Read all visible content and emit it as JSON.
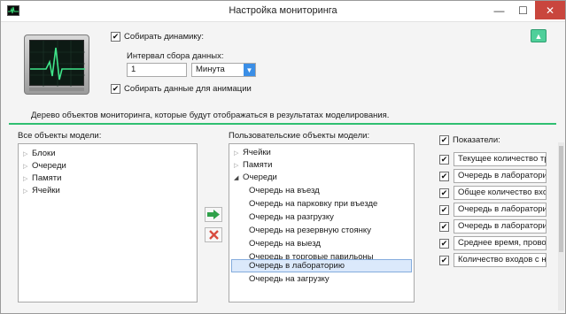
{
  "window": {
    "title": "Настройка мониторинга",
    "controls": {
      "minimize": "—",
      "maximize": "☐",
      "close": "✕"
    }
  },
  "settings": {
    "collect_dynamics_label": "Собирать динамику:",
    "collect_dynamics_checked": true,
    "interval_label": "Интервал сбора данных:",
    "interval_value": "1",
    "interval_unit": "Минута",
    "collect_animation_label": "Собирать данные для анимации",
    "collect_animation_checked": true
  },
  "info_text": "Дерево объектов мониторинга, которые будут отображаться в результатах моделирования.",
  "all_objects": {
    "label": "Все объекты модели:",
    "items": [
      "Блоки",
      "Очереди",
      "Памяти",
      "Ячейки"
    ]
  },
  "user_objects": {
    "label": "Пользовательские объекты модели:",
    "items": [
      {
        "text": "Ячейки",
        "level": 0,
        "expanded": false
      },
      {
        "text": "Памяти",
        "level": 0,
        "expanded": false
      },
      {
        "text": "Очереди",
        "level": 0,
        "expanded": true
      },
      {
        "text": "Очередь на въезд",
        "level": 1
      },
      {
        "text": "Очередь на парковку при въезде",
        "level": 1
      },
      {
        "text": "Очередь на разгрузку",
        "level": 1
      },
      {
        "text": "Очередь на резервную стоянку",
        "level": 1
      },
      {
        "text": "Очередь на выезд",
        "level": 1
      },
      {
        "text": "Очередь в торговые павильоны",
        "level": 1
      },
      {
        "text": "Очередь в лабораторию",
        "level": 1,
        "selected": true
      },
      {
        "text": "Очередь на загрузку",
        "level": 1
      }
    ]
  },
  "indicators": {
    "label": "Показатели:",
    "header_checked": true,
    "items": [
      {
        "text": "Текущее количество тран",
        "checked": true
      },
      {
        "text": "Очередь в лабораторию.",
        "checked": true
      },
      {
        "text": "Общее количество входо",
        "checked": true
      },
      {
        "text": "Очередь в лабораторию.",
        "checked": true
      },
      {
        "text": "Очередь в лабораторию.",
        "checked": true
      },
      {
        "text": "Среднее время, проводи",
        "checked": true
      },
      {
        "text": "Количество входов с нул",
        "checked": true
      }
    ]
  },
  "icons": {
    "add": "arrow-right-icon",
    "remove": "x-icon",
    "collapse": "chevron-up-icon",
    "monitor": "heartbeat-monitor-icon"
  },
  "colors": {
    "accent_green": "#2fbf71",
    "add_arrow": "#2fa14a",
    "remove_x": "#d84b3f",
    "select_arrow_bg": "#3a8ee6",
    "selection_bg": "#dbe9fb"
  }
}
